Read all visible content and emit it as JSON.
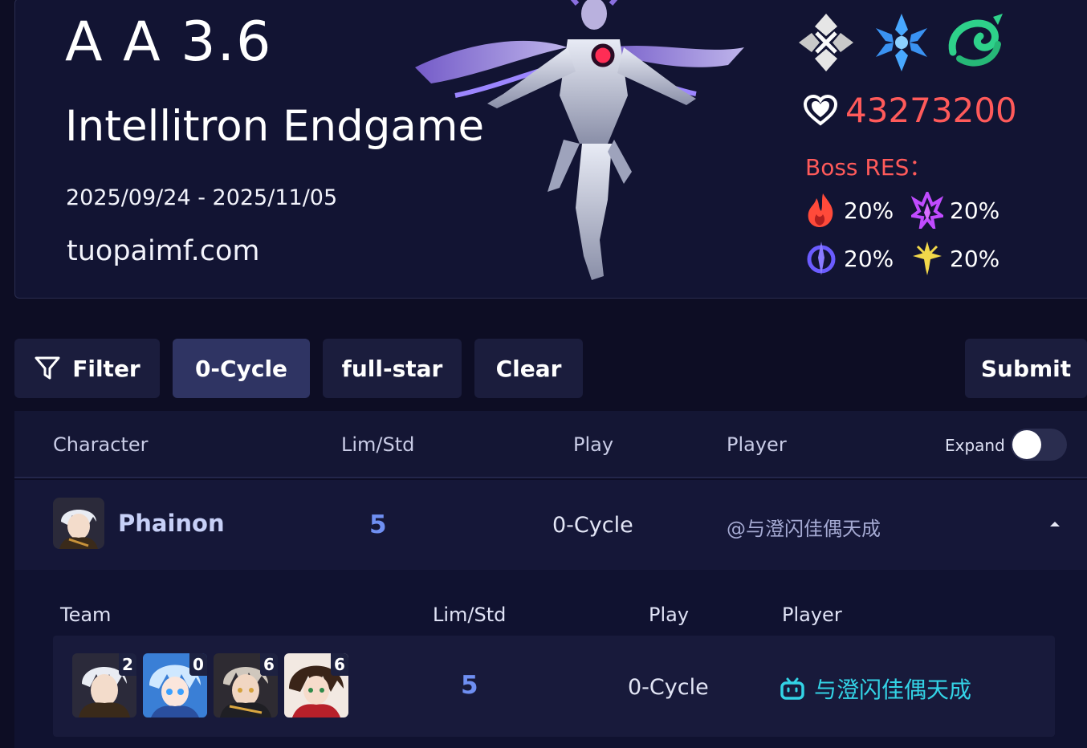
{
  "header": {
    "title": "A A 3.6",
    "subtitle": "Intellitron Endgame",
    "date_range": "2025/09/24 - 2025/11/05",
    "site": "tuopaimf.com",
    "weakness_icons": [
      "imaginary-icon",
      "ice-icon",
      "wind-icon"
    ],
    "hp": "43273200",
    "res_label": "Boss RES：",
    "resistances": [
      {
        "icon": "fire-icon",
        "value": "20%"
      },
      {
        "icon": "lightning-icon",
        "value": "20%"
      },
      {
        "icon": "quantum-icon",
        "value": "20%"
      },
      {
        "icon": "physical-icon",
        "value": "20%"
      }
    ]
  },
  "toolbar": {
    "filter_label": "Filter",
    "cycle_label": "0-Cycle",
    "fullstar_label": "full-star",
    "clear_label": "Clear",
    "submit_label": "Submit"
  },
  "table": {
    "headers": {
      "character": "Character",
      "limstd": "Lim/Std",
      "play": "Play",
      "player": "Player",
      "expand": "Expand"
    },
    "expand_on": false,
    "row": {
      "character": "Phainon",
      "limstd": "5",
      "play": "0-Cycle",
      "player": "@与澄闪佳偶天成"
    }
  },
  "detail": {
    "headers": {
      "team": "Team",
      "limstd": "Lim/Std",
      "play": "Play",
      "player": "Player"
    },
    "team_eidolons": [
      "2",
      "0",
      "6",
      "6"
    ],
    "limstd": "5",
    "play": "0-Cycle",
    "player": "与澄闪佳偶天成"
  },
  "colors": {
    "accent_blue": "#6f8ff2",
    "hp_red": "#ff5a5a",
    "link_cyan": "#33d3e6"
  }
}
